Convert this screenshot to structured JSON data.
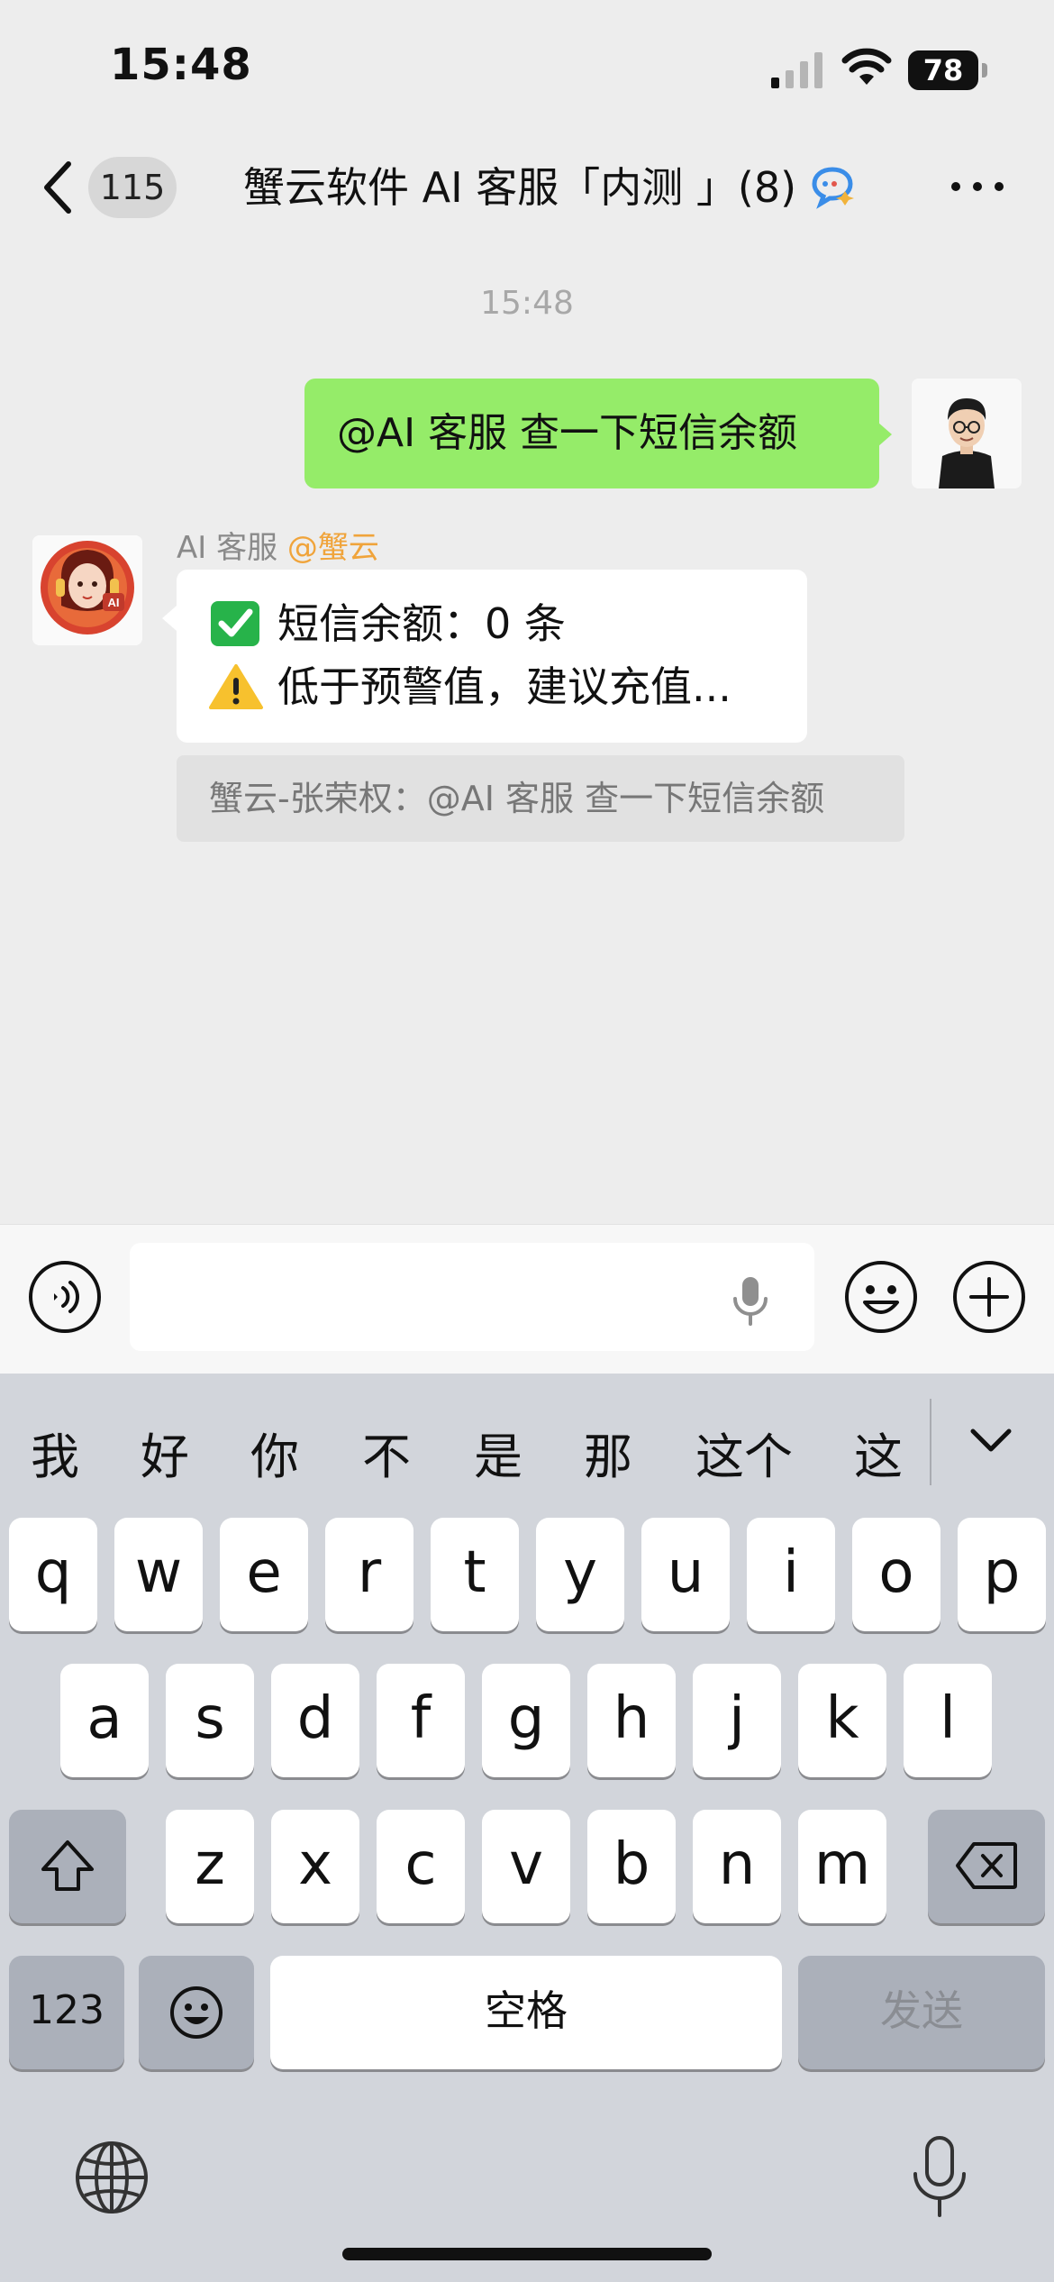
{
  "status_bar": {
    "time": "15:48",
    "battery": "78"
  },
  "nav": {
    "unread_count": "115",
    "title": "蟹云软件 AI 客服「内测 」(8)"
  },
  "conversation": {
    "timestamp": "15:48",
    "sent_message": "@AI 客服 查一下短信余额",
    "received": {
      "sender_name": "AI 客服",
      "sender_mention": "@蟹云",
      "line1": "短信余额：0 条",
      "line2": "低于预警值，建议充值...",
      "line1_icon": "check-mark-icon",
      "line2_icon": "warning-icon"
    },
    "quote": "蟹云-张荣权：@AI 客服 查一下短信余额"
  },
  "input_bar": {
    "placeholder": ""
  },
  "keyboard": {
    "candidates": [
      "我",
      "好",
      "你",
      "不",
      "是",
      "那",
      "这个",
      "这"
    ],
    "row1": [
      "q",
      "w",
      "e",
      "r",
      "t",
      "y",
      "u",
      "i",
      "o",
      "p"
    ],
    "row2": [
      "a",
      "s",
      "d",
      "f",
      "g",
      "h",
      "j",
      "k",
      "l"
    ],
    "row3": [
      "z",
      "x",
      "c",
      "v",
      "b",
      "n",
      "m"
    ],
    "numbers_label": "123",
    "space_label": "空格",
    "send_label": "发送"
  },
  "colors": {
    "sent_bubble": "#95ec69",
    "mention": "#f0a43b",
    "chat_background": "#ededed",
    "keyboard_background": "#d2d5db"
  }
}
